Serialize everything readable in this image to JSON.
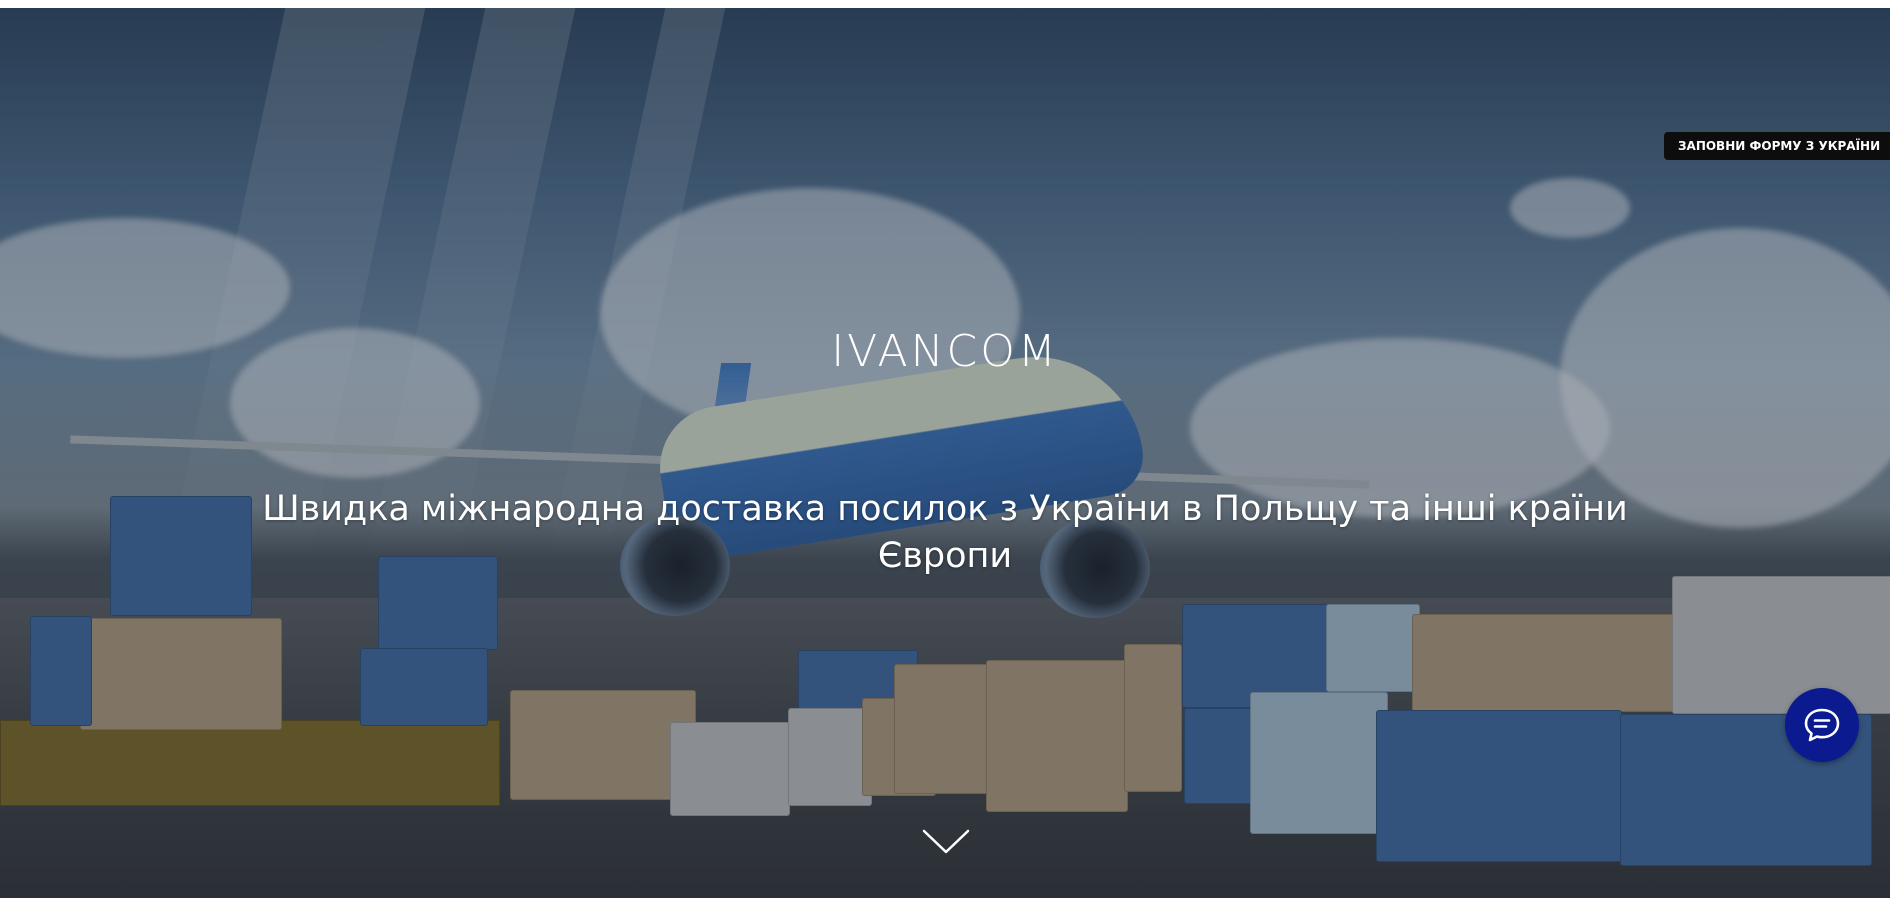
{
  "header": {
    "cta_label": "ЗАПОВНИ ФОРМУ З УКРАЇНИ"
  },
  "hero": {
    "logo": "IVANCOM",
    "headline": "Швидка міжнародна доставка посилок з України в Польщу та інші країни Європи"
  },
  "icons": {
    "chat": "chat-bubble-icon",
    "scroll": "chevron-down-icon"
  },
  "colors": {
    "chat_button": "#0b1a8f",
    "cta_button": "#0d0d0d",
    "text": "#ffffff"
  }
}
